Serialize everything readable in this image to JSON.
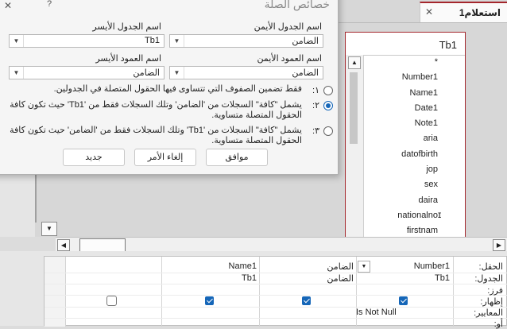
{
  "dialog": {
    "title": "خصائص الصلة",
    "close_glyph": "✕",
    "help_glyph": "?",
    "right_table_label": "اسم الجدول الأيمن",
    "left_table_label": "اسم الجدول الأيسر",
    "right_table_value": "الضامن",
    "left_table_value": "Tb1",
    "right_column_label": "اسم العمود الأيمن",
    "left_column_label": "اسم العمود الأيسر",
    "right_column_value": "الضامن",
    "left_column_value": "الضامن",
    "options": [
      {
        "number": "١:",
        "line1": "فقط تضمين الصفوف التي تتساوى فيها الحقول المتصلة في الجدولين.",
        "line2": "",
        "selected": false
      },
      {
        "number": "٢:",
        "line1": "يشمل \"كافة\" السجلات من 'الضامن' وتلك السجلات فقط من 'Tb1' حيث تكون كافة",
        "line2": "الحقول المتصلة متساوية.",
        "selected": true
      },
      {
        "number": "٣:",
        "line1": "يشمل \"كافة\" السجلات من 'Tb1' وتلك السجلات فقط من 'الضامن' حيث تكون كافة",
        "line2": "الحقول المتصلة متساوية.",
        "selected": false
      }
    ],
    "ok_label": "موافق",
    "cancel_label": "إلغاء الأمر",
    "new_label": "جديد"
  },
  "tab": {
    "label": "استعلام1",
    "close_glyph": "✕"
  },
  "table_box": {
    "title": "Tb1",
    "fields": [
      "*",
      "Number1",
      "Name1",
      "Date1",
      "Note1",
      "aria",
      "datofbirth",
      "jop",
      "sex",
      "daira",
      "nationalno",
      "firstnam"
    ]
  },
  "grid": {
    "row_labels": [
      "الحقل:",
      "الجدول:",
      "فرز:",
      "إظهار:",
      "المعايير:",
      "أو:"
    ],
    "columns": [
      {
        "field": "Number1",
        "table": "Tb1",
        "show": true,
        "criteria": "Is Not Null"
      },
      {
        "field": "الضامن",
        "table": "الضامن",
        "show": true,
        "criteria": ""
      },
      {
        "field": "Name1",
        "table": "Tb1",
        "show": true,
        "criteria": ""
      },
      {
        "field": "",
        "table": "",
        "show": false,
        "criteria": ""
      }
    ]
  },
  "icons": {
    "dropdown": "chevron-down-icon",
    "scroll_up": "triangle-up-icon",
    "scroll_left": "triangle-left-icon",
    "scroll_right": "triangle-right-icon",
    "scroll_down": "triangle-down-icon"
  },
  "colors": {
    "accent": "#1566b8",
    "table_border": "#a4262c"
  }
}
